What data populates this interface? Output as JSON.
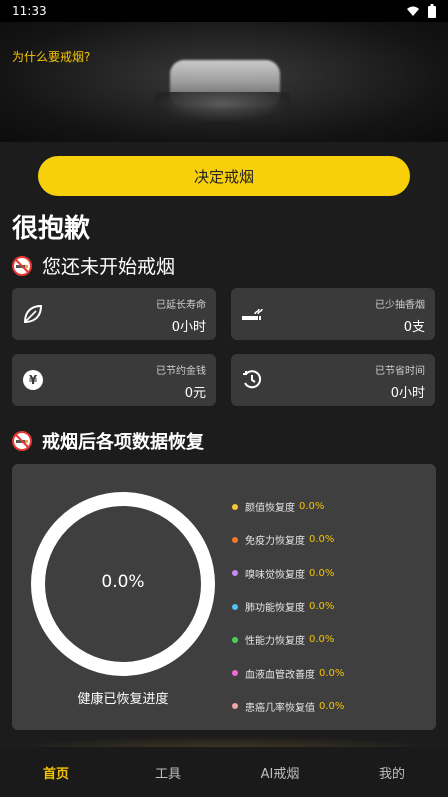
{
  "status_bar": {
    "time": "11:33",
    "icons": [
      "wifi-icon",
      "battery-icon"
    ]
  },
  "hero": {
    "question": "为什么要戒烟?"
  },
  "decide_button": {
    "label": "决定戒烟"
  },
  "headline": "很抱歉",
  "status_message": "您还未开始戒烟",
  "stats": [
    {
      "icon": "leaf-icon",
      "label": "已延长寿命",
      "value": "0小时"
    },
    {
      "icon": "cigarette-icon",
      "label": "已少抽香烟",
      "value": "0支"
    },
    {
      "icon": "money-icon",
      "label": "已节约金钱",
      "value": "0元"
    },
    {
      "icon": "clock-icon",
      "label": "已节省时间",
      "value": "0小时"
    }
  ],
  "recovery": {
    "title": "戒烟后各项数据恢复",
    "progress_value": "0.0%",
    "progress_fraction": 0,
    "progress_caption": "健康已恢复进度",
    "items": [
      {
        "label": "颜值恢复度",
        "value": "0.0%",
        "color": "#f7c531"
      },
      {
        "label": "免疫力恢复度",
        "value": "0.0%",
        "color": "#f07c2a"
      },
      {
        "label": "嗅味觉恢复度",
        "value": "0.0%",
        "color": "#c58cf7"
      },
      {
        "label": "肺功能恢复度",
        "value": "0.0%",
        "color": "#4fc3f7"
      },
      {
        "label": "性能力恢复度",
        "value": "0.0%",
        "color": "#48d15a"
      },
      {
        "label": "血液血管改善度",
        "value": "0.0%",
        "color": "#f06bd2"
      },
      {
        "label": "患癌几率恢复值",
        "value": "0.0%",
        "color": "#f2a3a3"
      }
    ]
  },
  "tabs": [
    {
      "label": "首页",
      "active": true
    },
    {
      "label": "工具",
      "active": false
    },
    {
      "label": "AI戒烟",
      "active": false
    },
    {
      "label": "我的",
      "active": false
    }
  ],
  "colors": {
    "accent": "#f7cf0b",
    "card_bg": "#3a3a3a",
    "panel_bg": "#3f3f3f"
  }
}
